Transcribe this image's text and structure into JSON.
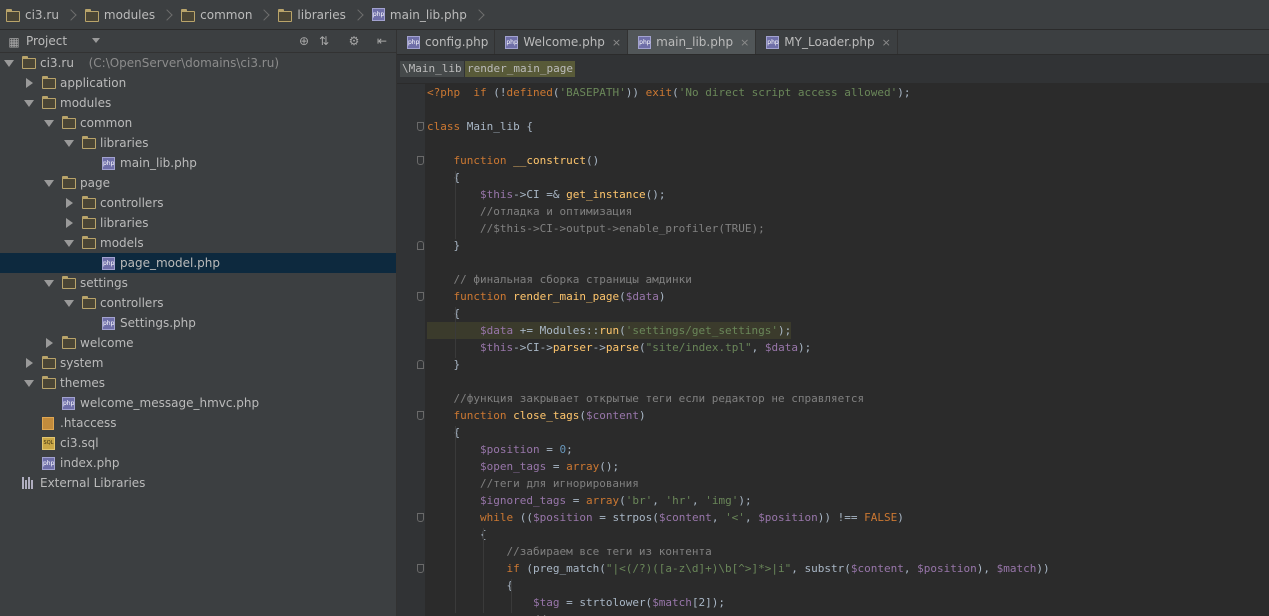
{
  "breadcrumbs": [
    "ci3.ru",
    "modules",
    "common",
    "libraries",
    "main_lib.php"
  ],
  "project": {
    "title": "Project",
    "tree": [
      {
        "label": "ci3.ru",
        "path": "(C:\\OpenServer\\domains\\ci3.ru)",
        "type": "folder",
        "depth": 0,
        "open": true
      },
      {
        "label": "application",
        "type": "folder",
        "depth": 1,
        "open": false
      },
      {
        "label": "modules",
        "type": "folder",
        "depth": 1,
        "open": true
      },
      {
        "label": "common",
        "type": "folder",
        "depth": 2,
        "open": true
      },
      {
        "label": "libraries",
        "type": "folder",
        "depth": 3,
        "open": true
      },
      {
        "label": "main_lib.php",
        "type": "php",
        "depth": 4
      },
      {
        "label": "page",
        "type": "folder",
        "depth": 2,
        "open": true
      },
      {
        "label": "controllers",
        "type": "folder",
        "depth": 3,
        "open": false
      },
      {
        "label": "libraries",
        "type": "folder",
        "depth": 3,
        "open": false
      },
      {
        "label": "models",
        "type": "folder",
        "depth": 3,
        "open": true
      },
      {
        "label": "page_model.php",
        "type": "php",
        "depth": 4,
        "selected": true
      },
      {
        "label": "settings",
        "type": "folder",
        "depth": 2,
        "open": true
      },
      {
        "label": "controllers",
        "type": "folder",
        "depth": 3,
        "open": true
      },
      {
        "label": "Settings.php",
        "type": "php",
        "depth": 4
      },
      {
        "label": "welcome",
        "type": "folder",
        "depth": 2,
        "open": false
      },
      {
        "label": "system",
        "type": "folder",
        "depth": 1,
        "open": false
      },
      {
        "label": "themes",
        "type": "folder",
        "depth": 1,
        "open": true
      },
      {
        "label": "welcome_message_hmvc.php",
        "type": "php",
        "depth": 2
      },
      {
        "label": ".htaccess",
        "type": "htaccess",
        "depth": 1
      },
      {
        "label": "ci3.sql",
        "type": "sql",
        "depth": 1
      },
      {
        "label": "index.php",
        "type": "php",
        "depth": 1
      },
      {
        "label": "External Libraries",
        "type": "libs",
        "depth": 0
      }
    ]
  },
  "tabs": [
    {
      "label": "config.php",
      "active": false
    },
    {
      "label": "Welcome.php",
      "active": false
    },
    {
      "label": "main_lib.php",
      "active": true
    },
    {
      "label": "MY_Loader.php",
      "active": false
    }
  ],
  "editor_breadcrumb": [
    "\\Main_lib",
    "render_main_page"
  ],
  "code": [
    [
      [
        "kw",
        "<?php"
      ],
      [
        "t",
        "  "
      ],
      [
        "kw",
        "if"
      ],
      [
        "t",
        " (!"
      ],
      [
        "kw",
        "defined"
      ],
      [
        "t",
        "("
      ],
      [
        "str",
        "'BASEPATH'"
      ],
      [
        "t",
        ")) "
      ],
      [
        "kw",
        "exit"
      ],
      [
        "t",
        "("
      ],
      [
        "str",
        "'No direct script access allowed'"
      ],
      [
        "t",
        ");"
      ]
    ],
    [],
    [
      [
        "kw",
        "class"
      ],
      [
        "t",
        " Main_lib {"
      ]
    ],
    [],
    [
      [
        "t",
        "    "
      ],
      [
        "kw",
        "function"
      ],
      [
        "t",
        " "
      ],
      [
        "fn",
        "__construct"
      ],
      [
        "t",
        "()"
      ]
    ],
    [
      [
        "t",
        "    {"
      ]
    ],
    [
      [
        "t",
        "        "
      ],
      [
        "var",
        "$this"
      ],
      [
        "t",
        "->CI =& "
      ],
      [
        "fn",
        "get_instance"
      ],
      [
        "t",
        "();"
      ]
    ],
    [
      [
        "t",
        "        "
      ],
      [
        "cm",
        "//отладка и оптимизация"
      ]
    ],
    [
      [
        "t",
        "        "
      ],
      [
        "cm",
        "//$this->CI->output->enable_profiler(TRUE);"
      ]
    ],
    [
      [
        "t",
        "    }"
      ]
    ],
    [],
    [
      [
        "t",
        "    "
      ],
      [
        "cm",
        "// финальная сборка страницы амдинки"
      ]
    ],
    [
      [
        "t",
        "    "
      ],
      [
        "kw",
        "function"
      ],
      [
        "t",
        " "
      ],
      [
        "fn",
        "render_main_page"
      ],
      [
        "t",
        "("
      ],
      [
        "var",
        "$data"
      ],
      [
        "t",
        ")"
      ]
    ],
    [
      [
        "t",
        "    {"
      ]
    ],
    [
      [
        "t",
        "        "
      ],
      [
        "var",
        "$data"
      ],
      [
        "t",
        " += Modules::"
      ],
      [
        "fn",
        "run"
      ],
      [
        "t",
        "("
      ],
      [
        "str",
        "'settings/get_settings'"
      ],
      [
        "t",
        ");"
      ]
    ],
    [
      [
        "t",
        "        "
      ],
      [
        "var",
        "$this"
      ],
      [
        "t",
        "->CI->"
      ],
      [
        "fn",
        "parser"
      ],
      [
        "t",
        "->"
      ],
      [
        "fn",
        "parse"
      ],
      [
        "t",
        "("
      ],
      [
        "str",
        "\"site/index.tpl\""
      ],
      [
        "t",
        ", "
      ],
      [
        "var",
        "$data"
      ],
      [
        "t",
        ");"
      ]
    ],
    [
      [
        "t",
        "    }"
      ]
    ],
    [],
    [
      [
        "t",
        "    "
      ],
      [
        "cm",
        "//функция закрывает открытые теги если редактор не справляется"
      ]
    ],
    [
      [
        "t",
        "    "
      ],
      [
        "kw",
        "function"
      ],
      [
        "t",
        " "
      ],
      [
        "fn",
        "close_tags"
      ],
      [
        "t",
        "("
      ],
      [
        "var",
        "$content"
      ],
      [
        "t",
        ")"
      ]
    ],
    [
      [
        "t",
        "    {"
      ]
    ],
    [
      [
        "t",
        "        "
      ],
      [
        "var",
        "$position"
      ],
      [
        "t",
        " = "
      ],
      [
        "num",
        "0"
      ],
      [
        "t",
        ";"
      ]
    ],
    [
      [
        "t",
        "        "
      ],
      [
        "var",
        "$open_tags"
      ],
      [
        "t",
        " = "
      ],
      [
        "kw",
        "array"
      ],
      [
        "t",
        "();"
      ]
    ],
    [
      [
        "t",
        "        "
      ],
      [
        "cm",
        "//теги для игнорирования"
      ]
    ],
    [
      [
        "t",
        "        "
      ],
      [
        "var",
        "$ignored_tags"
      ],
      [
        "t",
        " = "
      ],
      [
        "kw",
        "array"
      ],
      [
        "t",
        "("
      ],
      [
        "str",
        "'br'"
      ],
      [
        "t",
        ", "
      ],
      [
        "str",
        "'hr'"
      ],
      [
        "t",
        ", "
      ],
      [
        "str",
        "'img'"
      ],
      [
        "t",
        ");"
      ]
    ],
    [
      [
        "t",
        "        "
      ],
      [
        "kw",
        "while"
      ],
      [
        "t",
        " (("
      ],
      [
        "var",
        "$position"
      ],
      [
        "t",
        " = strpos("
      ],
      [
        "var",
        "$content"
      ],
      [
        "t",
        ", "
      ],
      [
        "str",
        "'<'"
      ],
      [
        "t",
        ", "
      ],
      [
        "var",
        "$position"
      ],
      [
        "t",
        ")) !== "
      ],
      [
        "kw",
        "FALSE"
      ],
      [
        "t",
        ")"
      ]
    ],
    [
      [
        "t",
        "        {"
      ]
    ],
    [
      [
        "t",
        "            "
      ],
      [
        "cm",
        "//забираем все теги из контента"
      ]
    ],
    [
      [
        "t",
        "            "
      ],
      [
        "kw",
        "if"
      ],
      [
        "t",
        " (preg_match("
      ],
      [
        "str",
        "\"|<(/?)([a-z\\d]+)\\b[^>]*>|i\""
      ],
      [
        "t",
        ", substr("
      ],
      [
        "var",
        "$content"
      ],
      [
        "t",
        ", "
      ],
      [
        "var",
        "$position"
      ],
      [
        "t",
        "), "
      ],
      [
        "var",
        "$match"
      ],
      [
        "t",
        "))"
      ]
    ],
    [
      [
        "t",
        "            {"
      ]
    ],
    [
      [
        "t",
        "                "
      ],
      [
        "var",
        "$tag"
      ],
      [
        "t",
        " = strtolower("
      ],
      [
        "var",
        "$match"
      ],
      [
        "t",
        "[2]);"
      ]
    ],
    [
      [
        "t",
        "                "
      ],
      [
        "cm",
        "//..."
      ]
    ]
  ]
}
